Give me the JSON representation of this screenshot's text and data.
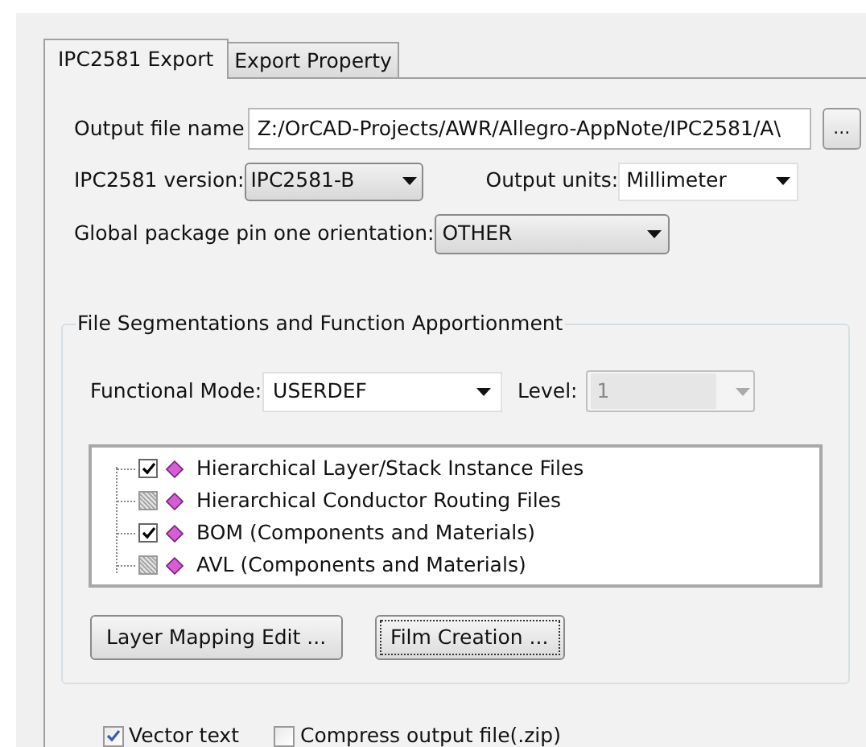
{
  "tabs": [
    {
      "label": "IPC2581 Export",
      "selected": true
    },
    {
      "label": "Export Property",
      "selected": false
    }
  ],
  "output_file": {
    "label": "Output file name",
    "value": "Z:/OrCAD-Projects/AWR/Allegro-AppNote/IPC2581/A\\",
    "browse_button": "..."
  },
  "version": {
    "label": "IPC2581 version:",
    "value": "IPC2581-B"
  },
  "units": {
    "label": "Output units:",
    "value": "Millimeter"
  },
  "pin_orientation": {
    "label": "Global package pin one orientation:",
    "value": "OTHER"
  },
  "group": {
    "title": "File Segmentations and Function Apportionment",
    "functional_mode": {
      "label": "Functional Mode:",
      "value": "USERDEF"
    },
    "level": {
      "label": "Level:",
      "value": "1",
      "disabled": true
    },
    "tree_items": [
      {
        "label": "Hierarchical Layer/Stack Instance Files",
        "checked": true,
        "disabled": false
      },
      {
        "label": "Hierarchical Conductor Routing Files",
        "checked": false,
        "disabled": true
      },
      {
        "label": "BOM (Components and Materials)",
        "checked": true,
        "disabled": false
      },
      {
        "label": "AVL (Components and Materials)",
        "checked": false,
        "disabled": true
      }
    ],
    "buttons": [
      {
        "label": "Layer Mapping Edit ...",
        "focused": false
      },
      {
        "label": "Film Creation ...",
        "focused": true
      }
    ]
  },
  "options": [
    {
      "label": "Vector text",
      "checked": true
    },
    {
      "label": "Compress output file(.zip)",
      "checked": false
    }
  ]
}
